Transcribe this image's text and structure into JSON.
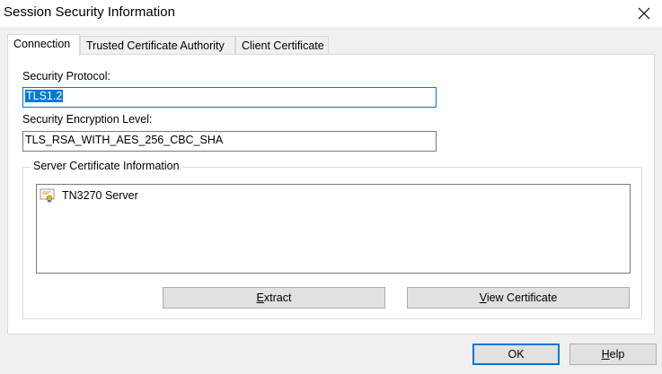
{
  "window": {
    "title": "Session Security Information",
    "close_icon": "close-icon"
  },
  "tabs": [
    {
      "label": "Connection",
      "active": true
    },
    {
      "label": "Trusted Certificate Authority",
      "active": false
    },
    {
      "label": "Client Certificate",
      "active": false
    }
  ],
  "connection": {
    "protocol_label": "Security Protocol:",
    "protocol_value": "TLS1.2",
    "encryption_label": "Security Encryption Level:",
    "encryption_value": "TLS_RSA_WITH_AES_256_CBC_SHA",
    "server_cert_group": "Server Certificate Information",
    "cert_items": [
      {
        "icon": "certificate-icon",
        "label": "TN3270 Server"
      }
    ],
    "extract_button": {
      "mnemonic": "E",
      "rest": "xtract"
    },
    "view_cert_button": {
      "mnemonic": "V",
      "rest": "iew Certificate"
    }
  },
  "footer": {
    "ok_label": "OK",
    "help_button": {
      "mnemonic": "H",
      "rest": "elp"
    }
  },
  "colors": {
    "accent": "#0078d7",
    "window_bg": "#f0f0f0",
    "panel_bg": "#ffffff"
  }
}
